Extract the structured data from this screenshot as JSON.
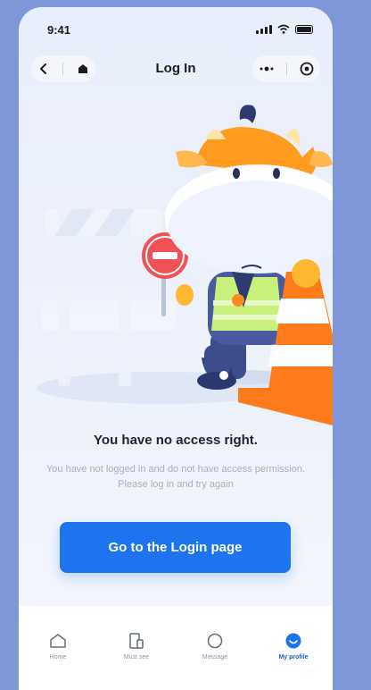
{
  "status_bar": {
    "time": "9:41"
  },
  "nav": {
    "title": "Log In"
  },
  "message": {
    "title": "You have no access right.",
    "description": "You have not logged in and do not have access permission. Please log in and try again"
  },
  "login_button": {
    "label": "Go to the Login page"
  },
  "tabs": [
    {
      "label": "Home",
      "icon": "home-icon"
    },
    {
      "label": "Must see",
      "icon": "document-icon"
    },
    {
      "label": "Message",
      "icon": "message-icon"
    },
    {
      "label": "My profile",
      "icon": "profile-icon",
      "active": true
    }
  ],
  "colors": {
    "accent": "#1d74ee",
    "background": "#7f97d8",
    "cone": "#ff7a1a"
  }
}
